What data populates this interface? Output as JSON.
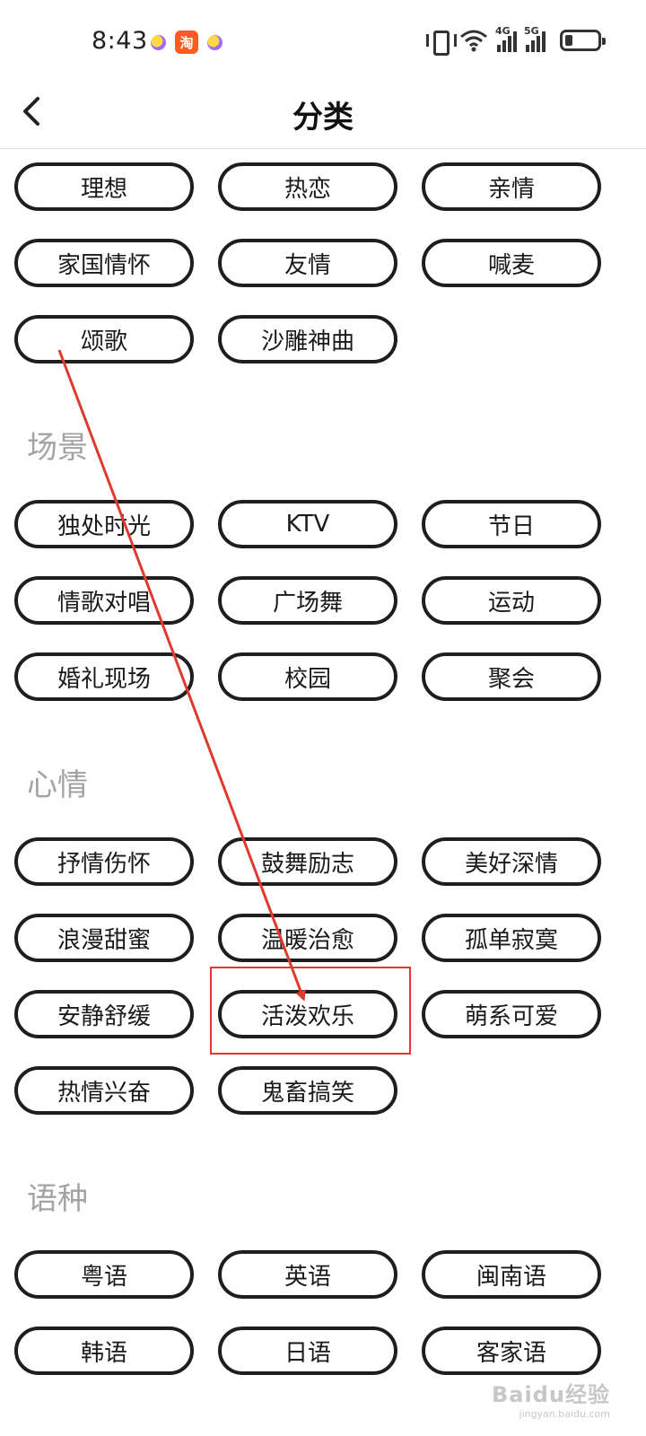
{
  "status_bar": {
    "time": "8:43",
    "net_4g": "4G",
    "net_5g": "5G"
  },
  "header": {
    "title": "分类"
  },
  "sections": {
    "top": {
      "tags": [
        "理想",
        "热恋",
        "亲情",
        "家国情怀",
        "友情",
        "喊麦",
        "颂歌",
        "沙雕神曲"
      ]
    },
    "scene": {
      "title": "场景",
      "tags": [
        "独处时光",
        "KTV",
        "节日",
        "情歌对唱",
        "广场舞",
        "运动",
        "婚礼现场",
        "校园",
        "聚会"
      ]
    },
    "mood": {
      "title": "心情",
      "tags": [
        "抒情伤怀",
        "鼓舞励志",
        "美好深情",
        "浪漫甜蜜",
        "温暖治愈",
        "孤单寂寞",
        "安静舒缓",
        "活泼欢乐",
        "萌系可爱",
        "热情兴奋",
        "鬼畜搞笑"
      ]
    },
    "language": {
      "title": "语种",
      "tags": [
        "粤语",
        "英语",
        "闽南语",
        "韩语",
        "日语",
        "客家语"
      ]
    }
  },
  "annotation": {
    "highlighted_tag": "活泼欢乐",
    "color": "#e03a2f"
  },
  "watermark": {
    "text": "Baidu经验",
    "url": "jingyan.baidu.com"
  }
}
